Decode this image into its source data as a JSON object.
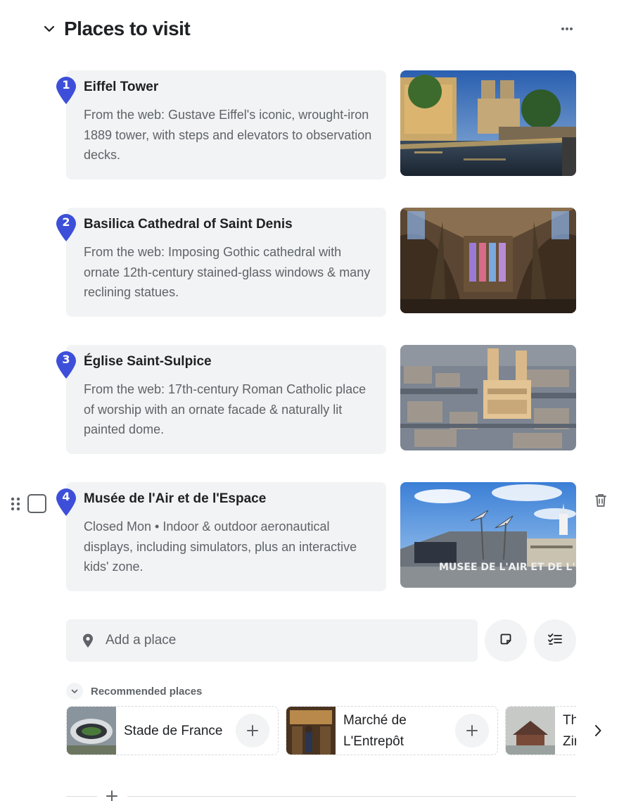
{
  "section": {
    "title": "Places to visit",
    "collapse_icon": "chevron-down-icon",
    "more_icon": "more-horizontal-icon"
  },
  "places": [
    {
      "number": "1",
      "name": "Eiffel Tower",
      "description": "From the web: Gustave Eiffel's iconic, wrought-iron 1889 tower, with steps and elevators to observation decks.",
      "photo": "riverside-cathedral-dusk-photo"
    },
    {
      "number": "2",
      "name": "Basilica Cathedral of Saint Denis",
      "description": "From the web: Imposing Gothic cathedral with ornate 12th-century stained-glass windows & many reclining statues.",
      "photo": "gothic-interior-stained-glass-photo"
    },
    {
      "number": "3",
      "name": "Église Saint-Sulpice",
      "description": "From the web: 17th-century Roman Catholic place of worship with an ornate facade & naturally lit painted dome.",
      "photo": "aerial-paris-church-photo"
    },
    {
      "number": "4",
      "name": "Musée de l'Air et de l'Espace",
      "description": "Closed Mon • Indoor & outdoor aeronautical displays, including simulators, plus an interactive kids' zone.",
      "photo": "air-space-museum-photo",
      "hovered": true
    }
  ],
  "photo_caption": "MUSEE DE L'AIR ET DE L'ESPACE",
  "add_place": {
    "placeholder": "Add a place",
    "note_icon": "sticky-note-icon",
    "checklist_icon": "checklist-icon"
  },
  "recommended": {
    "title": "Recommended places",
    "items": [
      {
        "name": "Stade de France"
      },
      {
        "name": "Marché de L'Entrepôt"
      },
      {
        "name": "Th Zir"
      }
    ]
  },
  "colors": {
    "pin": "#3d4fd9",
    "card_bg": "#f1f3f4",
    "text_primary": "#202124",
    "text_secondary": "#5f6368"
  }
}
